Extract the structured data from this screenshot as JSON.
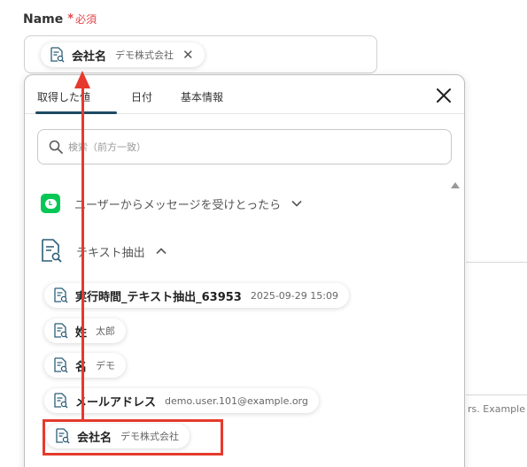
{
  "field": {
    "label": "Name",
    "required_star": "*",
    "required_text": "必須",
    "selected_chip": {
      "label": "会社名",
      "value": "デモ株式会社"
    }
  },
  "background": {
    "peek_text": "rs. Example"
  },
  "panel": {
    "tabs": [
      {
        "label": "取得した値",
        "active": true
      },
      {
        "label": "日付",
        "active": false
      },
      {
        "label": "基本情報",
        "active": false
      }
    ],
    "search_placeholder": "検索（前方一致）",
    "sections": [
      {
        "label": "ユーザーからメッセージを受けとったら",
        "icon": "line-app-icon",
        "expanded": false
      },
      {
        "label": "テキスト抽出",
        "icon": "document-search-icon",
        "expanded": true
      }
    ],
    "items": [
      {
        "label": "実行時間_テキスト抽出_63953",
        "value": "2025-09-29 15:09"
      },
      {
        "label": "姓",
        "value": "太郎"
      },
      {
        "label": "名",
        "value": "デモ"
      },
      {
        "label": "メールアドレス",
        "value": "demo.user.101@example.org"
      },
      {
        "label": "会社名",
        "value": "デモ株式会社"
      }
    ]
  },
  "colors": {
    "accent": "#1d4a63",
    "required": "#e2474a",
    "annotation_red": "#e53a2d",
    "line_green": "#06c755"
  }
}
